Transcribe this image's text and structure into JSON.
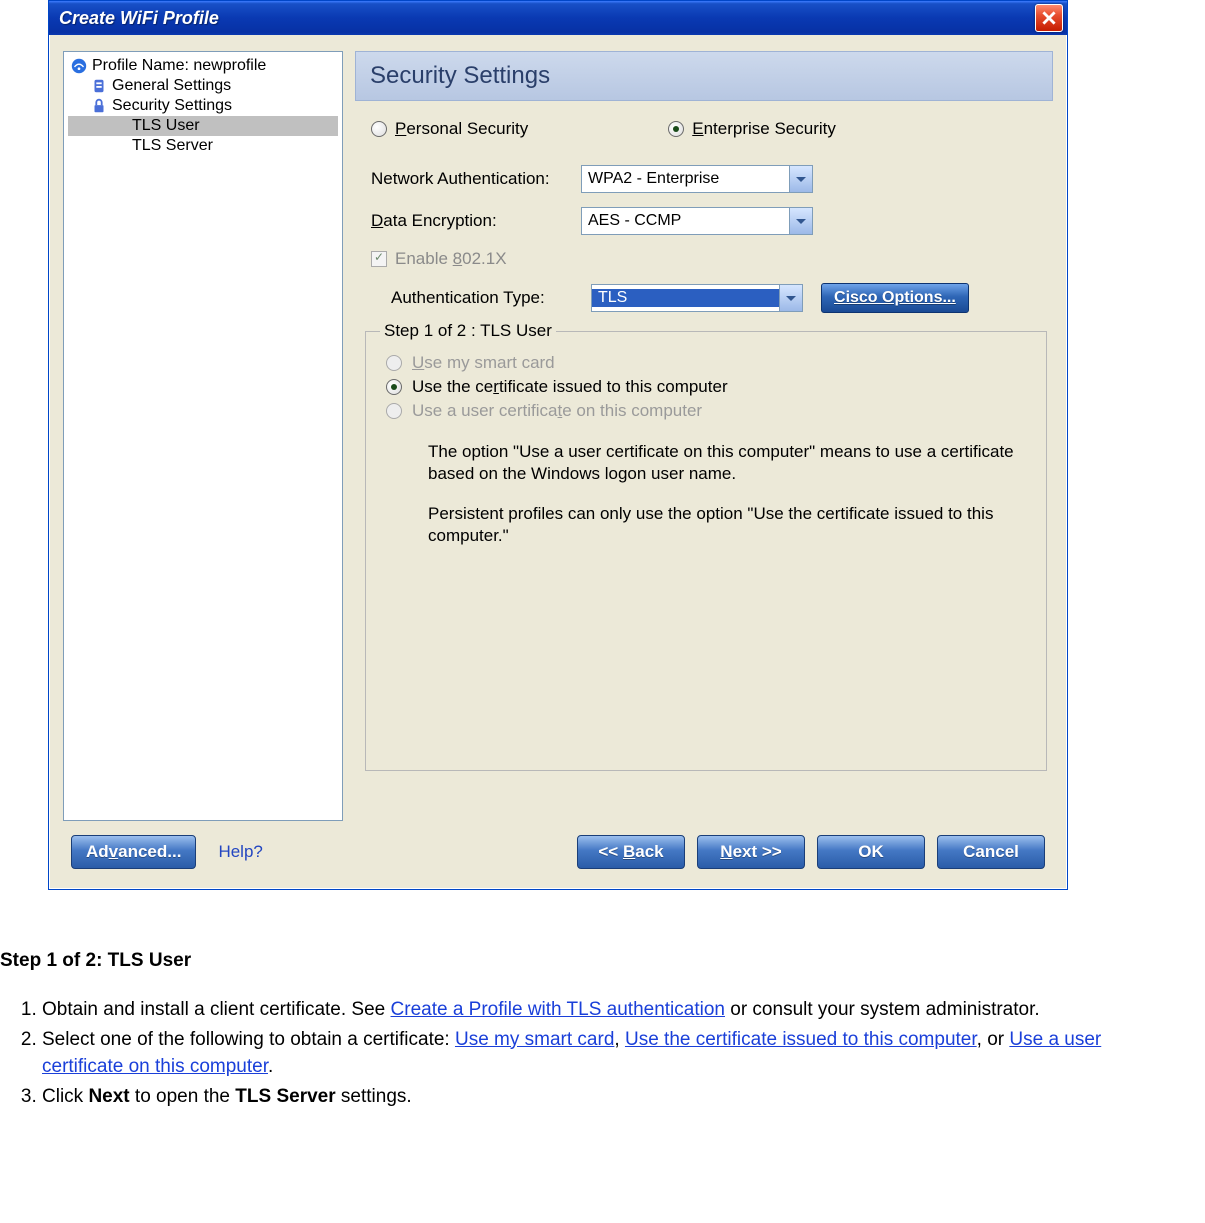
{
  "window": {
    "title": "Create WiFi Profile"
  },
  "tree": {
    "profile_prefix": "Profile Name: ",
    "profile_name": "newprofile",
    "general": "General Settings",
    "security": "Security Settings",
    "tls_user": "TLS User",
    "tls_server": "TLS Server"
  },
  "panel": {
    "heading": "Security Settings",
    "personal": "Personal Security",
    "enterprise": "Enterprise Security",
    "net_auth_label": "Network Authentication:",
    "net_auth_value": "WPA2 - Enterprise",
    "data_enc_label": "Data Encryption:",
    "data_enc_value": "AES - CCMP",
    "enable8021x": "Enable 802.1X",
    "auth_type_label": "Authentication Type:",
    "auth_type_value": "TLS",
    "cisco_btn": "Cisco Options...",
    "step_legend": "Step 1 of 2 : TLS User",
    "opt_smart": "Use my smart card",
    "opt_cert_computer": "Use the certificate issued to this computer",
    "opt_cert_user": "Use a user certificate on this computer",
    "explain1": "The option \"Use a user certificate on this computer\" means to use a certificate based on the Windows logon user name.",
    "explain2": "Persistent profiles can only use the option \"Use the certificate issued to this computer.\""
  },
  "buttons": {
    "advanced": "Advanced...",
    "help": "Help?",
    "back": "<< Back",
    "next": "Next >>",
    "ok": "OK",
    "cancel": "Cancel"
  },
  "doc": {
    "heading": "Step 1 of 2: TLS User",
    "li1a": "Obtain and install a client certificate. See ",
    "li1_link": "Create a Profile with TLS authentication",
    "li1b": " or consult your system administrator.",
    "li2a": "Select one of the following to obtain a certificate: ",
    "li2_link1": "Use my smart card",
    "li2_sep1": ", ",
    "li2_link2": "Use the certificate issued to this computer",
    "li2_sep2": ", or ",
    "li2_link3": "Use a user certificate on this computer",
    "li2b": ".",
    "li3a": "Click ",
    "li3_bold1": "Next",
    "li3b": " to open the ",
    "li3_bold2": "TLS Server",
    "li3c": " settings."
  }
}
